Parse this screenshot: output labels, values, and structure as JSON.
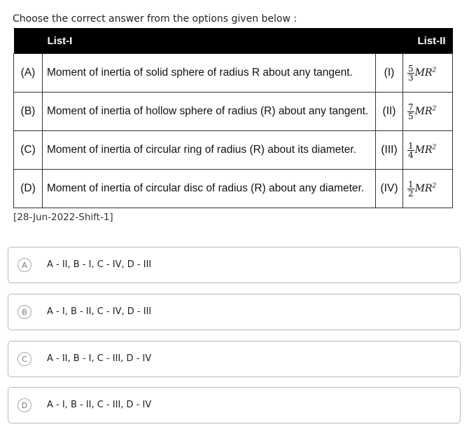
{
  "question": {
    "prompt": "Choose the correct answer from the options given below :",
    "list_headers": [
      "List-I",
      "List-II"
    ],
    "rows": [
      {
        "label": "(A)",
        "text": "Moment of inertia of solid sphere of radius R about any tangent.",
        "roman": "(I)",
        "formula": {
          "num": "5",
          "den": "3",
          "expr": "MR",
          "power": "2"
        }
      },
      {
        "label": "(B)",
        "text": "Moment of inertia of hollow sphere of radius (R) about any tangent.",
        "roman": "(II)",
        "formula": {
          "num": "7",
          "den": "5",
          "expr": "MR",
          "power": "2"
        }
      },
      {
        "label": "(C)",
        "text": "Moment of inertia of circular ring of radius (R) about its diameter.",
        "roman": "(III)",
        "formula": {
          "num": "1",
          "den": "4",
          "expr": "MR",
          "power": "2"
        }
      },
      {
        "label": "(D)",
        "text": "Moment of inertia of circular disc of radius (R) about any diameter.",
        "roman": "(IV)",
        "formula": {
          "num": "1",
          "den": "2",
          "expr": "MR",
          "power": "2"
        }
      }
    ],
    "source": "[28-Jun-2022-Shift-1]"
  },
  "options": [
    {
      "letter": "A",
      "text": "A - II, B - I, C - IV, D - III"
    },
    {
      "letter": "B",
      "text": "A - I, B - II, C - IV, D - III"
    },
    {
      "letter": "C",
      "text": "A - II, B - I, C - III, D - IV"
    },
    {
      "letter": "D",
      "text": "A - I, B - II, C - III, D - IV"
    }
  ]
}
